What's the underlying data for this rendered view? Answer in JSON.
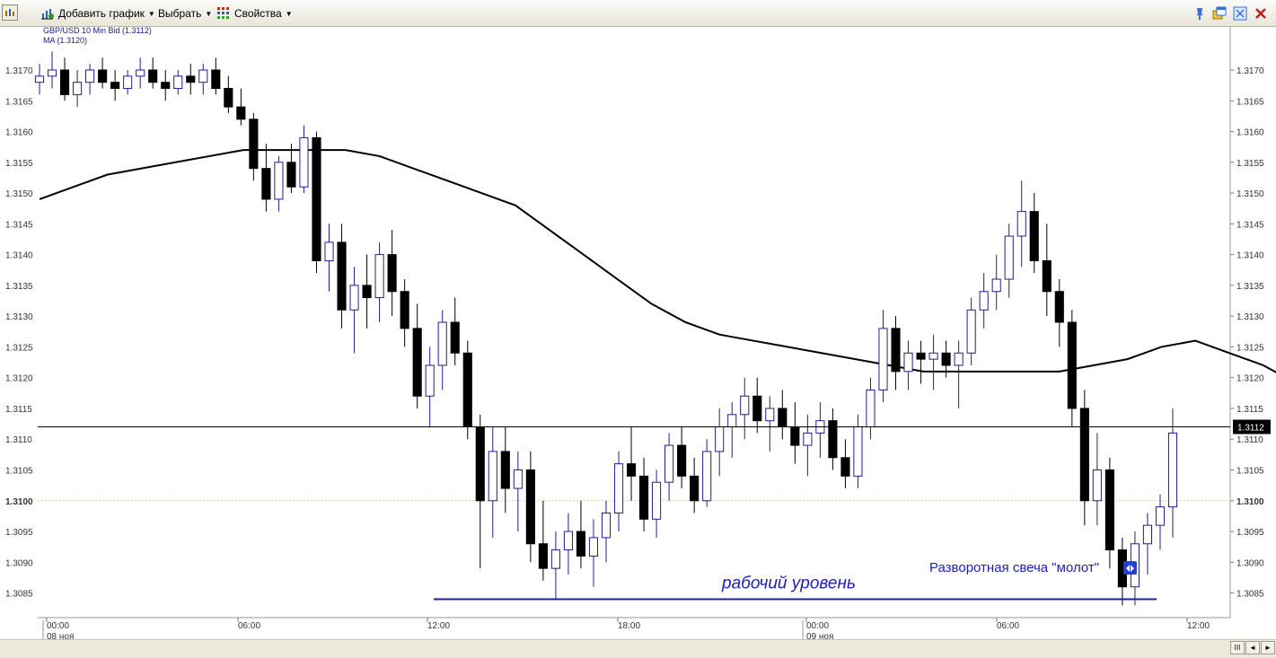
{
  "toolbar": {
    "add_chart_label": "Добавить график",
    "select_label": "Выбрать",
    "properties_label": "Свойства",
    "icons": [
      "chart-app-icon",
      "add-chart-icon",
      "properties-grid-icon",
      "pin-icon",
      "float-window-icon",
      "maximize-icon",
      "close-icon"
    ]
  },
  "chart_header": {
    "instrument": "GBP/USD 10 Min Bid (1.3112)",
    "indicator": "MA (1.3120)"
  },
  "colors": {
    "bull_candle_border": "#1f1f8f",
    "bear_candle_fill": "#000000",
    "ma_line": "#000000",
    "annotation_text": "#1d1dbf",
    "level_line": "#1d1d9f",
    "price_marker_bg": "#000000"
  },
  "chart_data": {
    "type": "candlestick",
    "instrument": "GBP/USD 10 Min Bid",
    "ylim": [
      1.3081,
      1.3177
    ],
    "y_ticks": [
      "1.3085",
      "1.3090",
      "1.3095",
      "1.3100",
      "1.3105",
      "1.3110",
      "1.3115",
      "1.3120",
      "1.3125",
      "1.3130",
      "1.3135",
      "1.3140",
      "1.3145",
      "1.3150",
      "1.3155",
      "1.3160",
      "1.3165",
      "1.3170"
    ],
    "x_ticks": [
      "00:00",
      "06:00",
      "12:00",
      "18:00",
      "00:00",
      "06:00",
      "12:00"
    ],
    "date_labels": [
      "08 ноя",
      "09 ноя"
    ],
    "current_price": "1.3112",
    "ma_value": "1.3120",
    "ma_series": [
      [
        0.0,
        1.3149
      ],
      [
        0.03,
        1.3151
      ],
      [
        0.06,
        1.3153
      ],
      [
        0.09,
        1.3154
      ],
      [
        0.12,
        1.3155
      ],
      [
        0.15,
        1.3156
      ],
      [
        0.18,
        1.3157
      ],
      [
        0.21,
        1.3157
      ],
      [
        0.24,
        1.3157
      ],
      [
        0.27,
        1.3157
      ],
      [
        0.3,
        1.3156
      ],
      [
        0.33,
        1.3154
      ],
      [
        0.36,
        1.3152
      ],
      [
        0.39,
        1.315
      ],
      [
        0.42,
        1.3148
      ],
      [
        0.45,
        1.3144
      ],
      [
        0.48,
        1.314
      ],
      [
        0.51,
        1.3136
      ],
      [
        0.54,
        1.3132
      ],
      [
        0.57,
        1.3129
      ],
      [
        0.6,
        1.3127
      ],
      [
        0.63,
        1.3126
      ],
      [
        0.66,
        1.3125
      ],
      [
        0.69,
        1.3124
      ],
      [
        0.72,
        1.3123
      ],
      [
        0.75,
        1.3122
      ],
      [
        0.78,
        1.3121
      ],
      [
        0.81,
        1.3121
      ],
      [
        0.84,
        1.3121
      ],
      [
        0.87,
        1.3121
      ],
      [
        0.9,
        1.3121
      ],
      [
        0.93,
        1.3122
      ],
      [
        0.96,
        1.3123
      ],
      [
        0.99,
        1.3125
      ],
      [
        1.02,
        1.3126
      ],
      [
        1.05,
        1.3124
      ],
      [
        1.08,
        1.3122
      ],
      [
        1.1,
        1.312
      ]
    ],
    "candles": [
      [
        1.3168,
        1.3171,
        1.3166,
        1.3169
      ],
      [
        1.3169,
        1.3173,
        1.3167,
        1.317
      ],
      [
        1.317,
        1.3172,
        1.3165,
        1.3166
      ],
      [
        1.3166,
        1.317,
        1.3164,
        1.3168
      ],
      [
        1.3168,
        1.3171,
        1.3166,
        1.317
      ],
      [
        1.317,
        1.3172,
        1.3167,
        1.3168
      ],
      [
        1.3168,
        1.317,
        1.3165,
        1.3167
      ],
      [
        1.3167,
        1.317,
        1.3166,
        1.3169
      ],
      [
        1.3169,
        1.3172,
        1.3167,
        1.317
      ],
      [
        1.317,
        1.3172,
        1.3167,
        1.3168
      ],
      [
        1.3168,
        1.317,
        1.3165,
        1.3167
      ],
      [
        1.3167,
        1.317,
        1.3166,
        1.3169
      ],
      [
        1.3169,
        1.3171,
        1.3166,
        1.3168
      ],
      [
        1.3168,
        1.3171,
        1.3166,
        1.317
      ],
      [
        1.317,
        1.3172,
        1.3166,
        1.3167
      ],
      [
        1.3167,
        1.3169,
        1.3163,
        1.3164
      ],
      [
        1.3164,
        1.3167,
        1.3161,
        1.3162
      ],
      [
        1.3162,
        1.3163,
        1.3152,
        1.3154
      ],
      [
        1.3154,
        1.3158,
        1.3147,
        1.3149
      ],
      [
        1.3149,
        1.3156,
        1.3147,
        1.3155
      ],
      [
        1.3155,
        1.3158,
        1.315,
        1.3151
      ],
      [
        1.3151,
        1.3161,
        1.315,
        1.3159
      ],
      [
        1.3159,
        1.316,
        1.3137,
        1.3139
      ],
      [
        1.3139,
        1.3145,
        1.3134,
        1.3142
      ],
      [
        1.3142,
        1.3145,
        1.3128,
        1.3131
      ],
      [
        1.3131,
        1.3138,
        1.3124,
        1.3135
      ],
      [
        1.3135,
        1.314,
        1.3128,
        1.3133
      ],
      [
        1.3133,
        1.3142,
        1.3129,
        1.314
      ],
      [
        1.314,
        1.3144,
        1.313,
        1.3134
      ],
      [
        1.3134,
        1.3136,
        1.3125,
        1.3128
      ],
      [
        1.3128,
        1.3132,
        1.3115,
        1.3117
      ],
      [
        1.3117,
        1.3125,
        1.3112,
        1.3122
      ],
      [
        1.3122,
        1.3131,
        1.3118,
        1.3129
      ],
      [
        1.3129,
        1.3133,
        1.3122,
        1.3124
      ],
      [
        1.3124,
        1.3126,
        1.311,
        1.3112
      ],
      [
        1.3112,
        1.3114,
        1.3089,
        1.31
      ],
      [
        1.31,
        1.3112,
        1.3094,
        1.3108
      ],
      [
        1.3108,
        1.3112,
        1.3098,
        1.3102
      ],
      [
        1.3102,
        1.3108,
        1.3095,
        1.3105
      ],
      [
        1.3105,
        1.3108,
        1.309,
        1.3093
      ],
      [
        1.3093,
        1.31,
        1.3087,
        1.3089
      ],
      [
        1.3089,
        1.3095,
        1.3084,
        1.3092
      ],
      [
        1.3092,
        1.3098,
        1.3088,
        1.3095
      ],
      [
        1.3095,
        1.31,
        1.3089,
        1.3091
      ],
      [
        1.3091,
        1.3097,
        1.3086,
        1.3094
      ],
      [
        1.3094,
        1.31,
        1.309,
        1.3098
      ],
      [
        1.3098,
        1.3108,
        1.3095,
        1.3106
      ],
      [
        1.3106,
        1.3112,
        1.31,
        1.3104
      ],
      [
        1.3104,
        1.3107,
        1.3095,
        1.3097
      ],
      [
        1.3097,
        1.3105,
        1.3094,
        1.3103
      ],
      [
        1.3103,
        1.3111,
        1.31,
        1.3109
      ],
      [
        1.3109,
        1.3112,
        1.3102,
        1.3104
      ],
      [
        1.3104,
        1.3107,
        1.3098,
        1.31
      ],
      [
        1.31,
        1.311,
        1.3099,
        1.3108
      ],
      [
        1.3108,
        1.3115,
        1.3104,
        1.3112
      ],
      [
        1.3112,
        1.3116,
        1.3107,
        1.3114
      ],
      [
        1.3114,
        1.312,
        1.311,
        1.3117
      ],
      [
        1.3117,
        1.312,
        1.3111,
        1.3113
      ],
      [
        1.3113,
        1.3117,
        1.3108,
        1.3115
      ],
      [
        1.3115,
        1.3118,
        1.311,
        1.3112
      ],
      [
        1.3112,
        1.3116,
        1.3106,
        1.3109
      ],
      [
        1.3109,
        1.3114,
        1.3104,
        1.3111
      ],
      [
        1.3111,
        1.3116,
        1.3107,
        1.3113
      ],
      [
        1.3113,
        1.3115,
        1.3105,
        1.3107
      ],
      [
        1.3107,
        1.311,
        1.3102,
        1.3104
      ],
      [
        1.3104,
        1.3114,
        1.3102,
        1.3112
      ],
      [
        1.3112,
        1.312,
        1.311,
        1.3118
      ],
      [
        1.3118,
        1.3131,
        1.3116,
        1.3128
      ],
      [
        1.3128,
        1.313,
        1.3118,
        1.3121
      ],
      [
        1.3121,
        1.3126,
        1.3118,
        1.3124
      ],
      [
        1.3124,
        1.3126,
        1.3119,
        1.3123
      ],
      [
        1.3123,
        1.3127,
        1.3118,
        1.3124
      ],
      [
        1.3124,
        1.3126,
        1.312,
        1.3122
      ],
      [
        1.3122,
        1.3126,
        1.3115,
        1.3124
      ],
      [
        1.3124,
        1.3133,
        1.3122,
        1.3131
      ],
      [
        1.3131,
        1.3137,
        1.3128,
        1.3134
      ],
      [
        1.3134,
        1.314,
        1.3131,
        1.3136
      ],
      [
        1.3136,
        1.3145,
        1.3133,
        1.3143
      ],
      [
        1.3143,
        1.3152,
        1.3138,
        1.3147
      ],
      [
        1.3147,
        1.315,
        1.3137,
        1.3139
      ],
      [
        1.3139,
        1.3145,
        1.313,
        1.3134
      ],
      [
        1.3134,
        1.3136,
        1.3125,
        1.3129
      ],
      [
        1.3129,
        1.3131,
        1.3112,
        1.3115
      ],
      [
        1.3115,
        1.3118,
        1.3096,
        1.31
      ],
      [
        1.31,
        1.3111,
        1.3096,
        1.3105
      ],
      [
        1.3105,
        1.3107,
        1.3089,
        1.3092
      ],
      [
        1.3092,
        1.3094,
        1.3083,
        1.3086
      ],
      [
        1.3086,
        1.3095,
        1.3083,
        1.3093
      ],
      [
        1.3093,
        1.3098,
        1.3088,
        1.3096
      ],
      [
        1.3096,
        1.3101,
        1.3092,
        1.3099
      ],
      [
        1.3099,
        1.3115,
        1.3094,
        1.3111
      ]
    ],
    "level": {
      "price": 1.3084,
      "label": "рабочий уровень"
    },
    "annotations": {
      "hammer_label": "Разворотная свеча \"молот\"",
      "hammer_price": 1.3089
    }
  },
  "status": {
    "scroll_controls": [
      "III",
      "◄",
      "►"
    ]
  }
}
